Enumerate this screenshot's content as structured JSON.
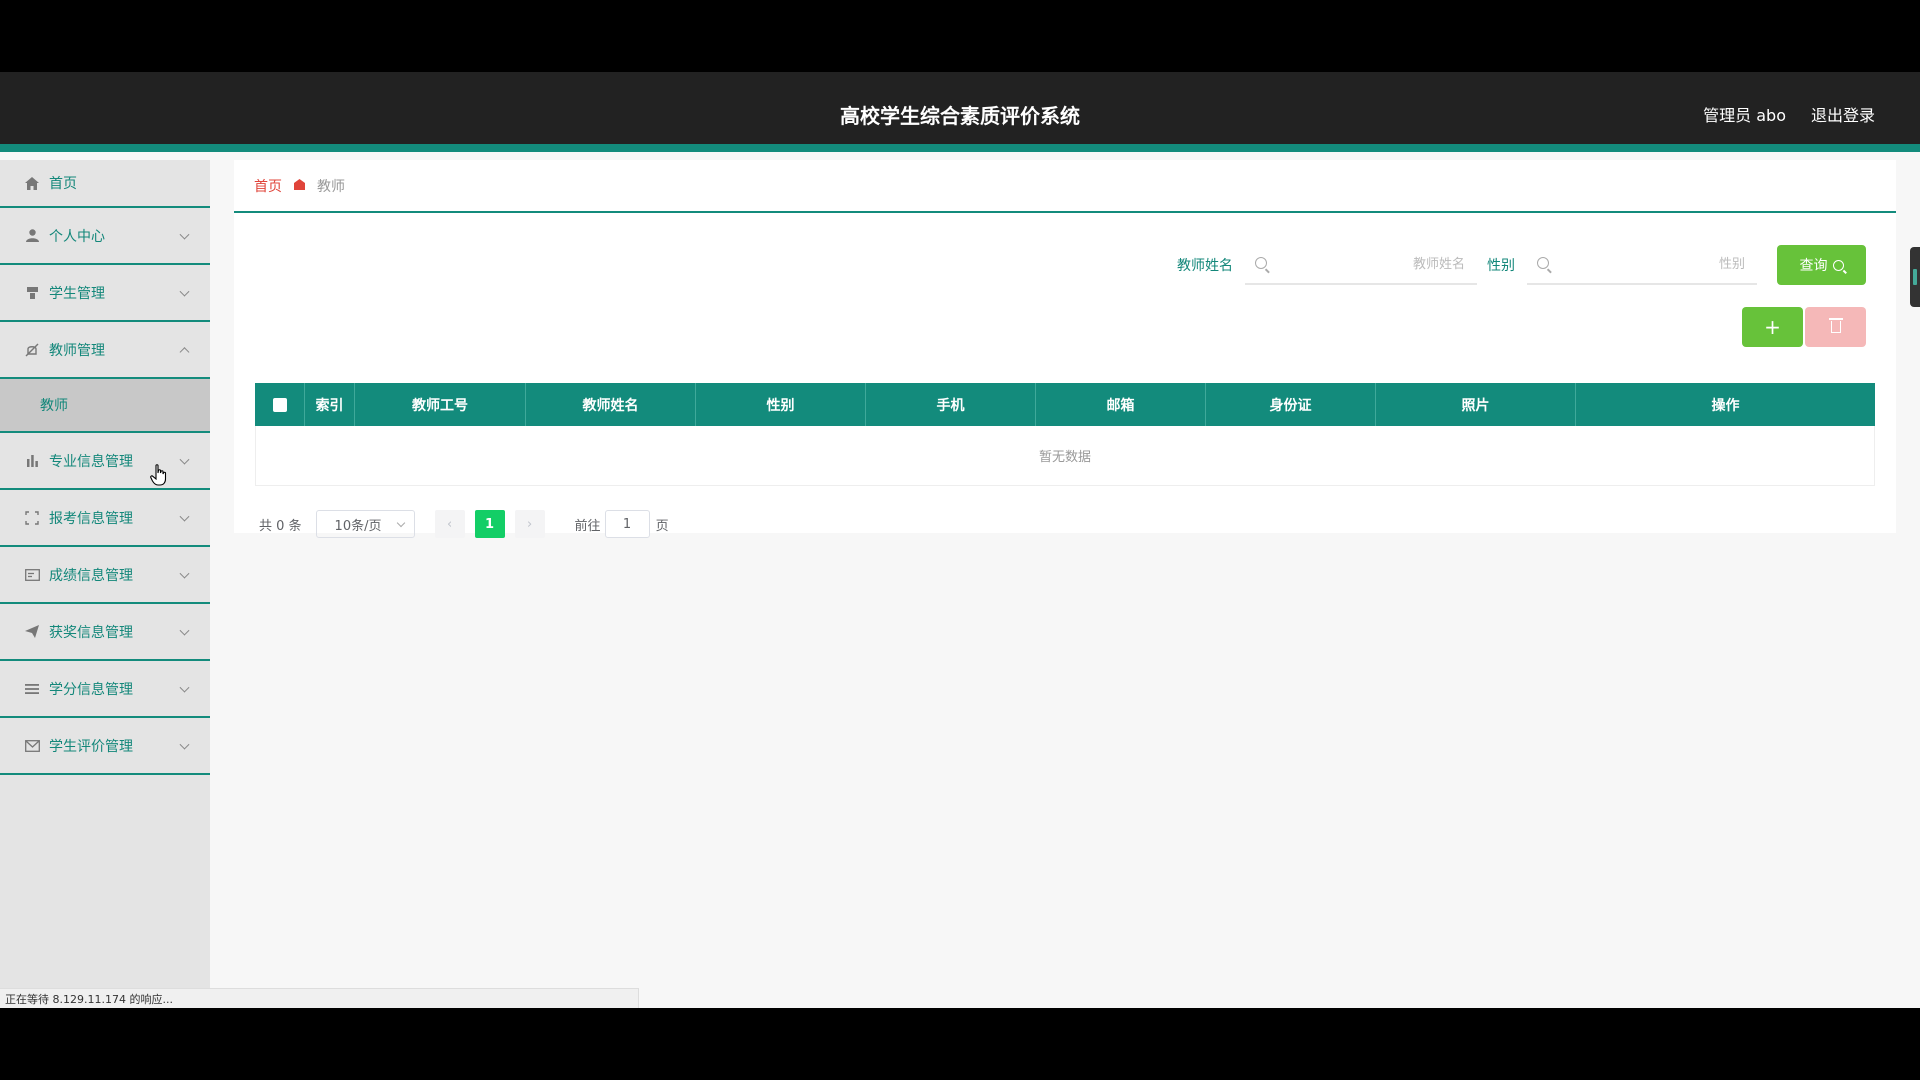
{
  "header": {
    "title": "高校学生综合素质评价系统",
    "user": "管理员 abo",
    "logout": "退出登录"
  },
  "sidebar": {
    "items": [
      {
        "label": "首页",
        "icon": "home-icon"
      },
      {
        "label": "个人中心",
        "icon": "user-icon"
      },
      {
        "label": "学生管理",
        "icon": "student-icon"
      },
      {
        "label": "教师管理",
        "icon": "teacher-icon",
        "expanded": true,
        "children": [
          {
            "label": "教师"
          }
        ]
      },
      {
        "label": "专业信息管理",
        "icon": "bar-chart-icon"
      },
      {
        "label": "报考信息管理",
        "icon": "scan-icon"
      },
      {
        "label": "成绩信息管理",
        "icon": "card-icon"
      },
      {
        "label": "获奖信息管理",
        "icon": "send-icon"
      },
      {
        "label": "学分信息管理",
        "icon": "list-icon"
      },
      {
        "label": "学生评价管理",
        "icon": "mail-icon"
      }
    ]
  },
  "breadcrumb": {
    "home": "首页",
    "current": "教师"
  },
  "search": {
    "name_label": "教师姓名",
    "name_placeholder": "教师姓名",
    "name_value": "",
    "gender_label": "性别",
    "gender_placeholder": "性别",
    "gender_value": "",
    "query_label": "查询"
  },
  "actions": {
    "add_label": "+"
  },
  "table": {
    "columns": [
      "索引",
      "教师工号",
      "教师姓名",
      "性别",
      "手机",
      "邮箱",
      "身份证",
      "照片",
      "操作"
    ],
    "empty_text": "暂无数据"
  },
  "pagination": {
    "total": "共 0 条",
    "page_size": "10条/页",
    "current_page": "1",
    "goto_label": "前往",
    "goto_value": "1",
    "page_suffix": "页"
  },
  "status_bar": {
    "text": "正在等待 8.129.11.174 的响应..."
  },
  "colors": {
    "header_bg": "#222222",
    "accent": "#138b7c",
    "button_green": "#67c23a",
    "delete_pink": "#f5b8b8",
    "breadcrumb_red": "#e0443a",
    "page_active": "#13ce66"
  }
}
